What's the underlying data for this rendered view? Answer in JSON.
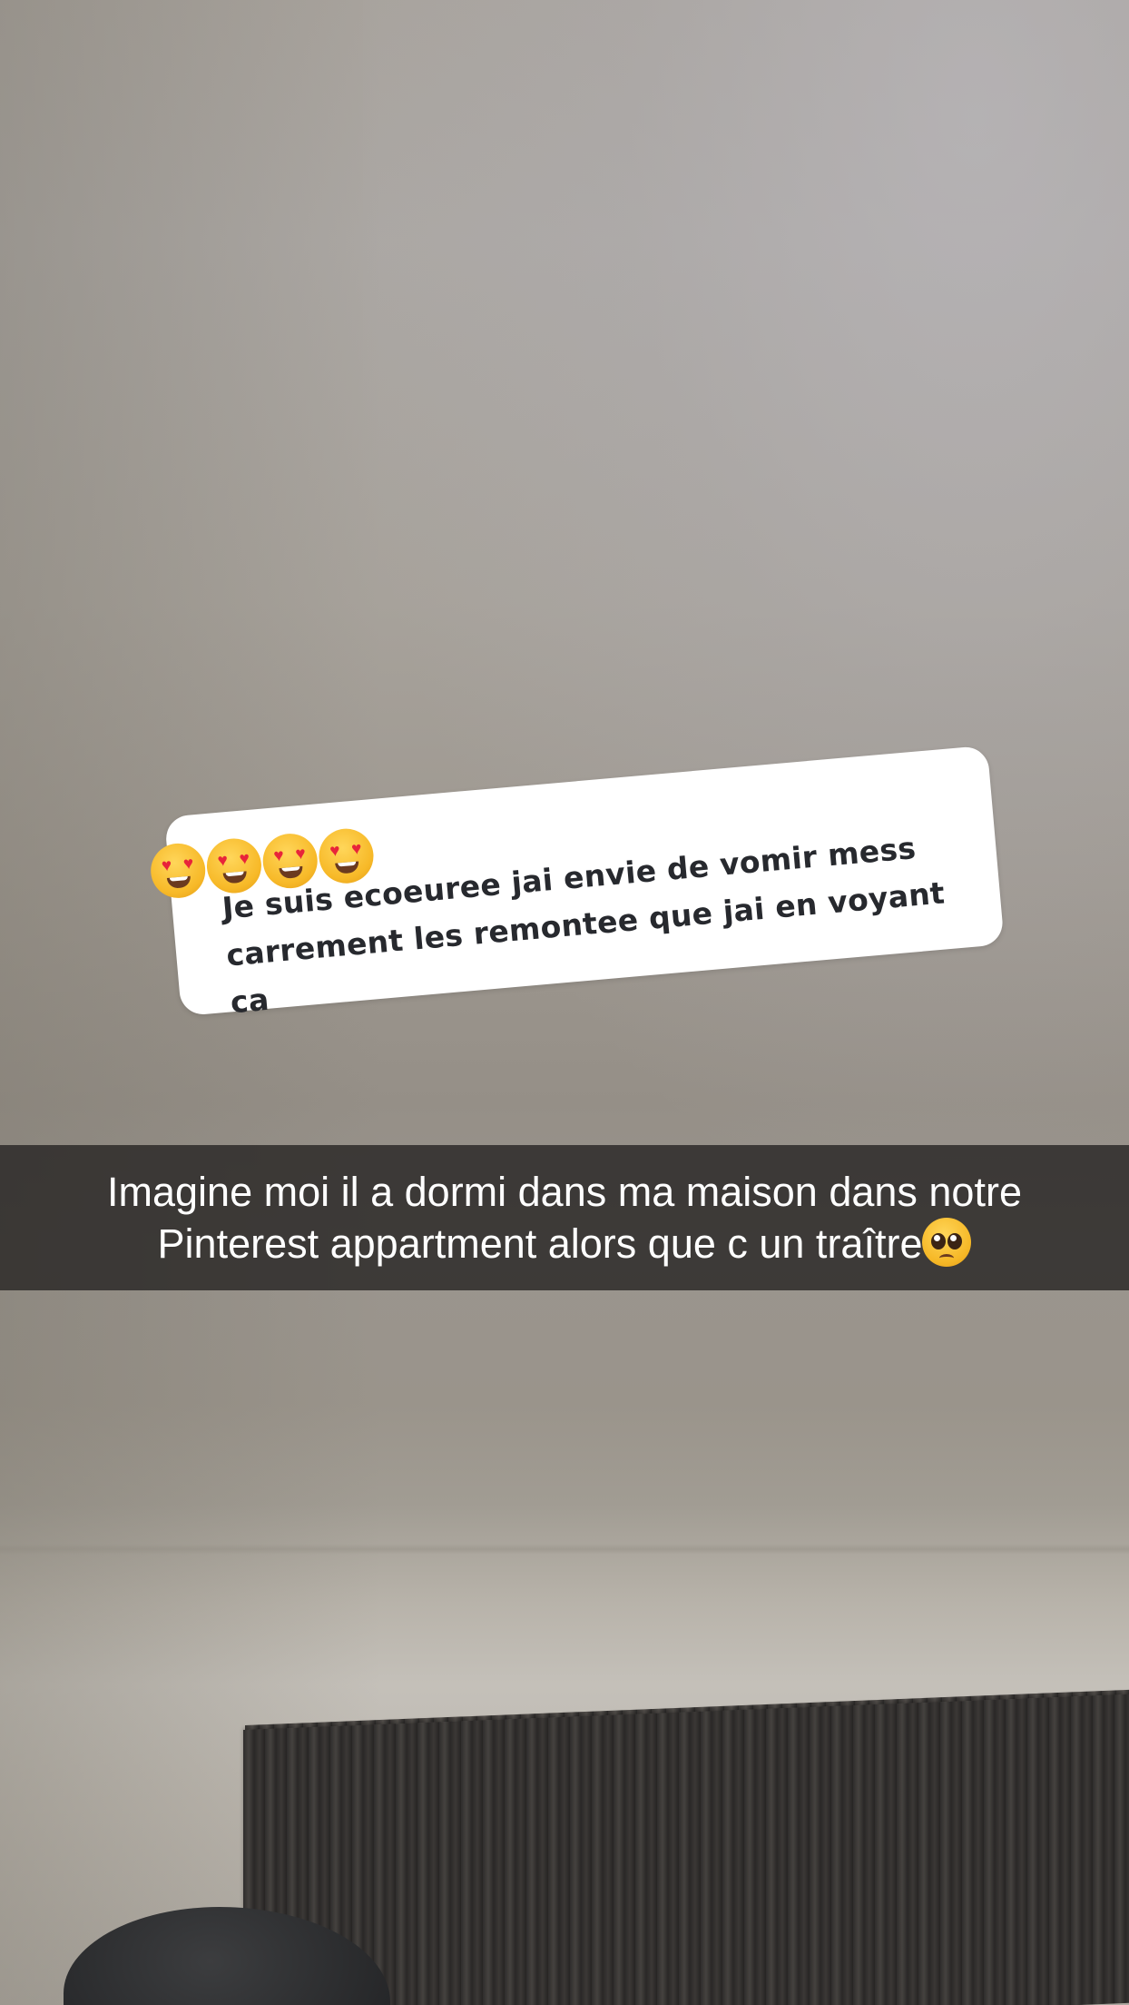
{
  "background": {
    "scene": "ceiling-and-curtain-photo"
  },
  "sticker": {
    "emojis": [
      "heart-eyes",
      "heart-eyes",
      "heart-eyes",
      "heart-eyes"
    ],
    "line1": "Je suis ecoeuree jai envie de vomir mess",
    "line2": "carrement les remontee que jai en voyant ca"
  },
  "caption": {
    "line1": "Imagine moi il a dormi dans ma maison dans notre",
    "line2": "Pinterest appartment alors que c un traître",
    "emoji": "pleading-face"
  },
  "colors": {
    "caption_bar": "#282624",
    "sticker_bg": "#ffffff",
    "sticker_text": "#27292e"
  }
}
